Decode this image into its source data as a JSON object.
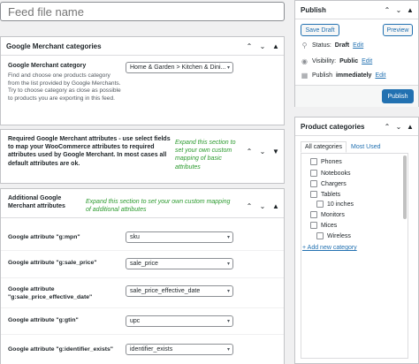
{
  "title_field": {
    "placeholder": "Feed file name"
  },
  "merchant_categories": {
    "title": "Google Merchant categories",
    "field_label": "Google Merchant category",
    "description": "Find and choose one products category from the list provided by Google Merchants. Try to choose category as close as possible to products you are exporting in this feed.",
    "selected": "Home & Garden > Kitchen & Dini..."
  },
  "required_attrs": {
    "title": "Required Google Merchant attributes - use select fields to map your WooCommerce attributes to required attributes used by Google Merchant. In most cases all default attributes are ok.",
    "note": "Expand this section to set your own custom mapping of basic attributes"
  },
  "additional_attrs": {
    "title": "Additional Google Merchant attributes",
    "note": "Expand this section to set your own custom mapping of additional attributes",
    "rows": [
      {
        "label": "Google attribute \"g:mpn\"",
        "value": "sku"
      },
      {
        "label": "Google attribute \"g:sale_price\"",
        "value": "sale_price"
      },
      {
        "label": "Google attribute \"g:sale_price_effective_date\"",
        "value": "sale_price_effective_date"
      },
      {
        "label": "Google attribute \"g:gtin\"",
        "value": "upc"
      },
      {
        "label": "Google attribute \"g:identifier_exists\"",
        "value": "identifier_exists"
      }
    ]
  },
  "publish": {
    "title": "Publish",
    "save_draft": "Save Draft",
    "preview": "Preview",
    "status_label": "Status:",
    "status_value": "Draft",
    "visibility_label": "Visibility:",
    "visibility_value": "Public",
    "publish_label": "Publish",
    "publish_value": "immediately",
    "edit": "Edit",
    "publish_button": "Publish"
  },
  "product_categories": {
    "title": "Product categories",
    "tab_all": "All categories",
    "tab_used": "Most Used",
    "items": [
      {
        "label": "Phones"
      },
      {
        "label": "Notebooks"
      },
      {
        "label": "Chargers"
      },
      {
        "label": "Tablets"
      },
      {
        "label": "10 inches"
      },
      {
        "label": "Monitors"
      },
      {
        "label": "Mices"
      },
      {
        "label": "Wireless"
      }
    ],
    "add_new": "+ Add new category"
  },
  "colors": {
    "accent": "#2271b1",
    "note_green": "#2b9a2e",
    "border": "#c3c4c7"
  },
  "icons": {
    "collapse_up": "chevron-up-icon",
    "collapse_down": "chevron-down-icon",
    "toggle": "triangle-toggle-icon"
  }
}
